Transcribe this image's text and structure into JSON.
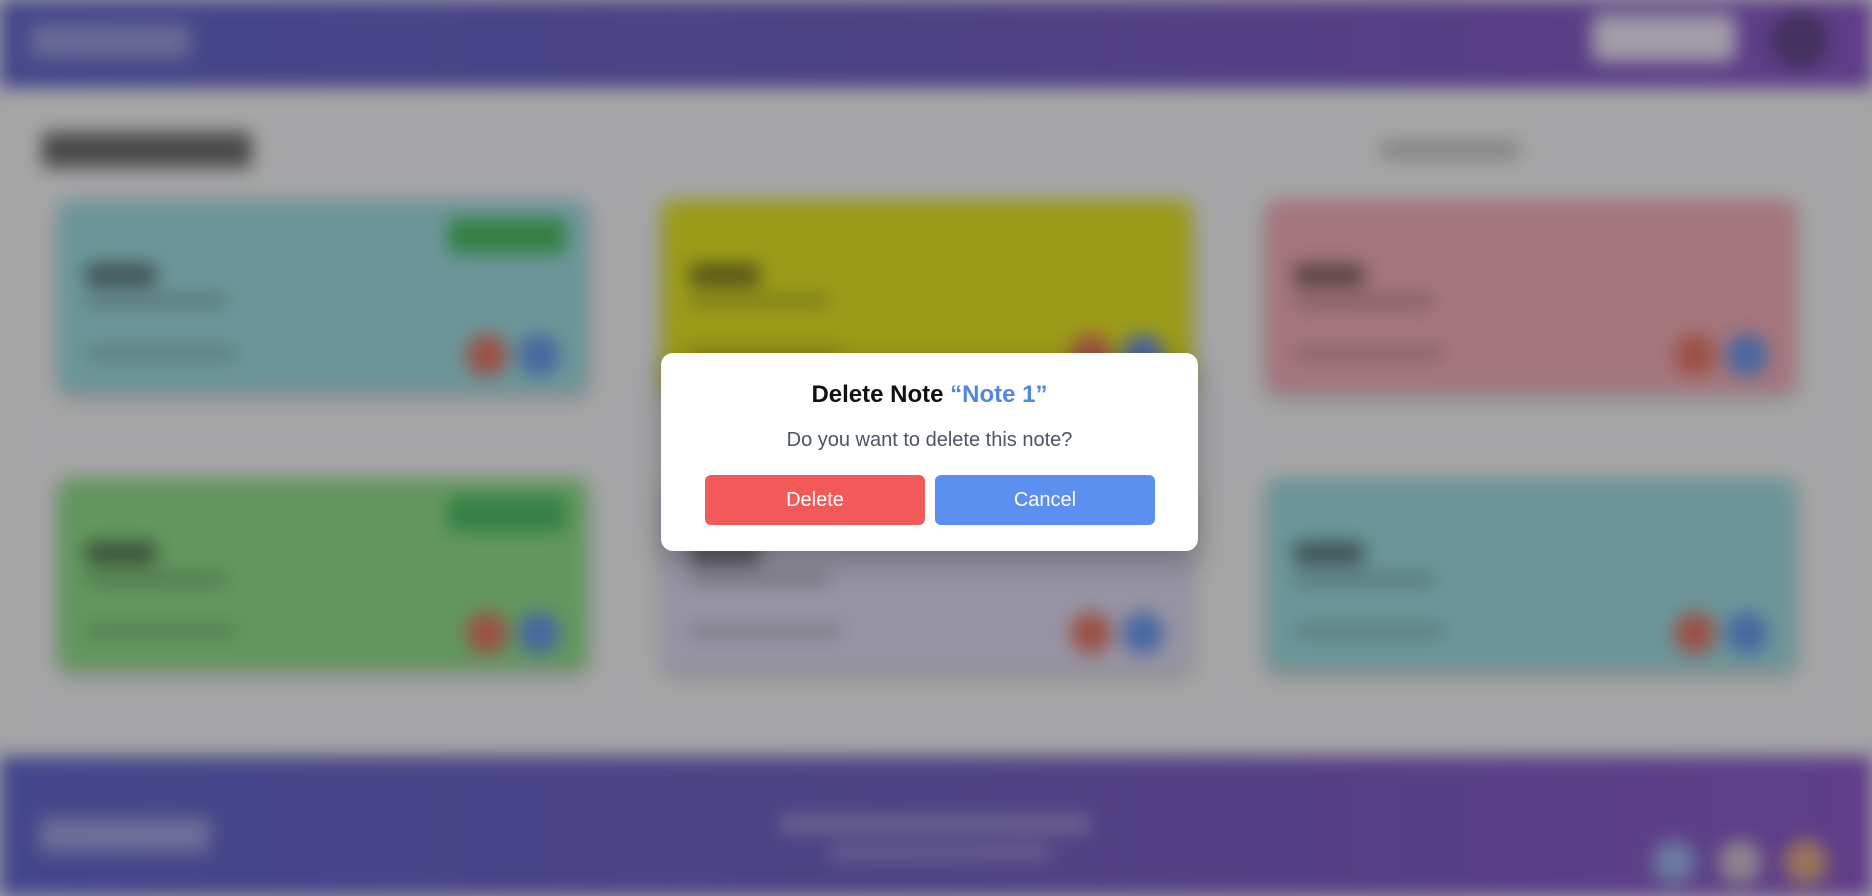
{
  "modal": {
    "title_prefix": "Delete Note",
    "note_name": "“Note 1”",
    "message": "Do you want to delete this note?",
    "delete_label": "Delete",
    "cancel_label": "Cancel"
  },
  "colors": {
    "accent": "#4f86e8",
    "danger": "#f25a5a",
    "header_gradient_start": "#4b4fc4",
    "header_gradient_end": "#7a3fc0"
  },
  "background_cards": [
    {
      "color": "#8fd6dc",
      "has_badge": true
    },
    {
      "color": "#e2e000",
      "has_badge": false
    },
    {
      "color": "#f0a0ac",
      "has_badge": false
    },
    {
      "color": "#7fd878",
      "has_badge": true
    },
    {
      "color": "#d8d4ee",
      "has_badge": true
    },
    {
      "color": "#8fd6dc",
      "has_badge": false
    }
  ],
  "icons": [
    "avatar",
    "note-delete-icon",
    "note-edit-icon",
    "social-icon"
  ]
}
